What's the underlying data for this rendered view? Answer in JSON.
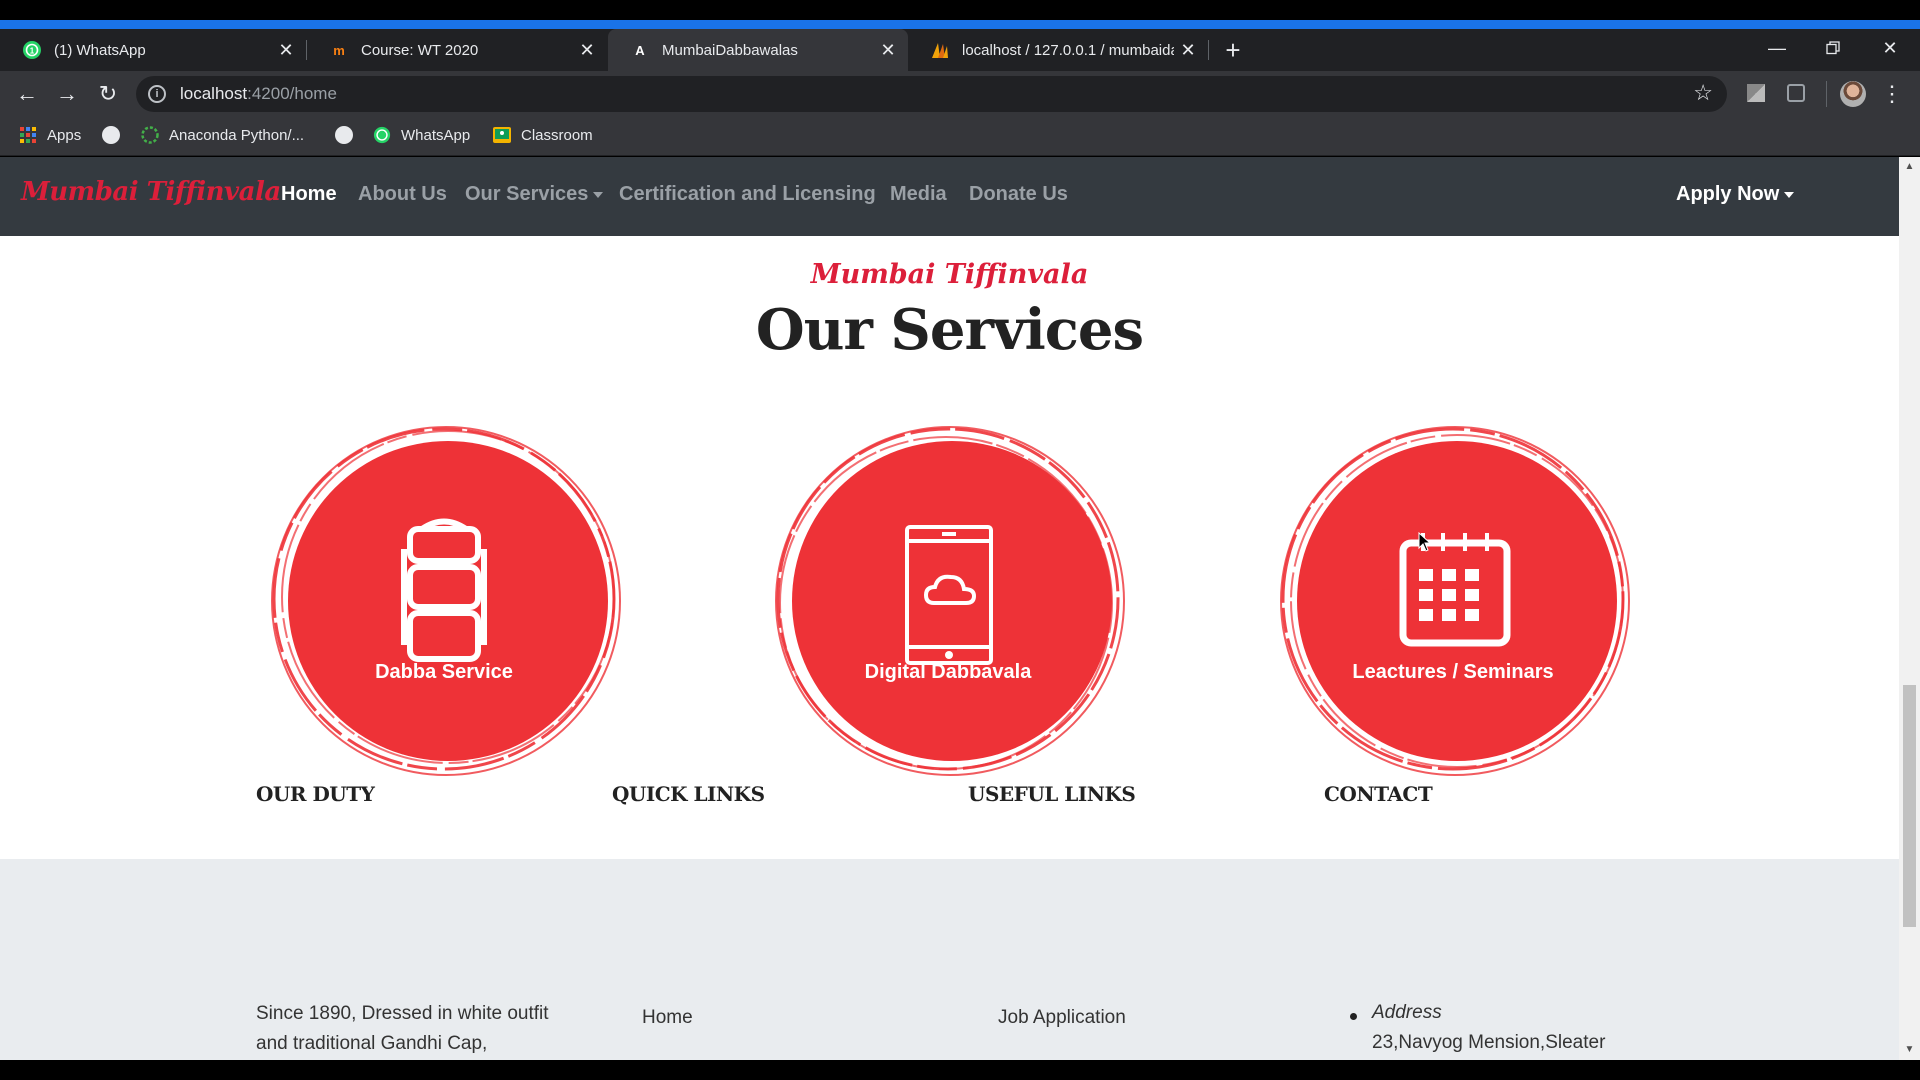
{
  "browser": {
    "tabs": [
      {
        "title": "(1) WhatsApp",
        "icon": "whatsapp-icon"
      },
      {
        "title": "Course: WT 2020",
        "icon": "moodle-icon"
      },
      {
        "title": "MumbaiDabbawalas",
        "icon": "angular-icon",
        "active": true
      },
      {
        "title": "localhost / 127.0.0.1 / mumbaida",
        "icon": "phpmyadmin-icon"
      }
    ],
    "url_host": "localhost",
    "url_path": ":4200/home",
    "bookmarks": [
      {
        "label": "Apps",
        "icon": "apps-grid-icon"
      },
      {
        "label": "Anaconda Python/...",
        "icon": "anaconda-icon"
      },
      {
        "label": "WhatsApp",
        "icon": "whatsapp-icon"
      },
      {
        "label": "Classroom",
        "icon": "classroom-icon"
      }
    ]
  },
  "site": {
    "brand": "Mumbai Tiffinvala",
    "nav": [
      {
        "label": "Home",
        "active": true
      },
      {
        "label": "About Us"
      },
      {
        "label": "Our Services",
        "dropdown": true
      },
      {
        "label": "Certification and Licensing"
      },
      {
        "label": "Media"
      },
      {
        "label": "Donate Us"
      }
    ],
    "apply_now": "Apply Now"
  },
  "services_section": {
    "subtitle": "Mumbai Tiffinvala",
    "title": "Our Services",
    "items": [
      {
        "label": "Dabba Service",
        "icon": "tiffin-box-icon"
      },
      {
        "label": "Digital Dabbavala",
        "icon": "phone-cloud-icon"
      },
      {
        "label": "Leactures / Seminars",
        "icon": "calendar-icon"
      }
    ]
  },
  "footer": {
    "our_duty": {
      "heading": "OUR DUTY",
      "text_line1": "Since 1890, Dressed in white outfit",
      "text_line2": "and traditional Gandhi Cap,"
    },
    "quick_links": {
      "heading": "QUICK LINKS",
      "first_link": "Home"
    },
    "useful_links": {
      "heading": "USEFUL LINKS",
      "first_link": "Job Application"
    },
    "contact": {
      "heading": "CONTACT",
      "address_label": "Address",
      "address_line": "23,Navyog Mension,Sleater"
    }
  },
  "colors": {
    "brand_red": "#dc1f3a",
    "service_red": "#ee3237",
    "navbar": "#343a40",
    "footer_bg": "#e9ecef"
  }
}
